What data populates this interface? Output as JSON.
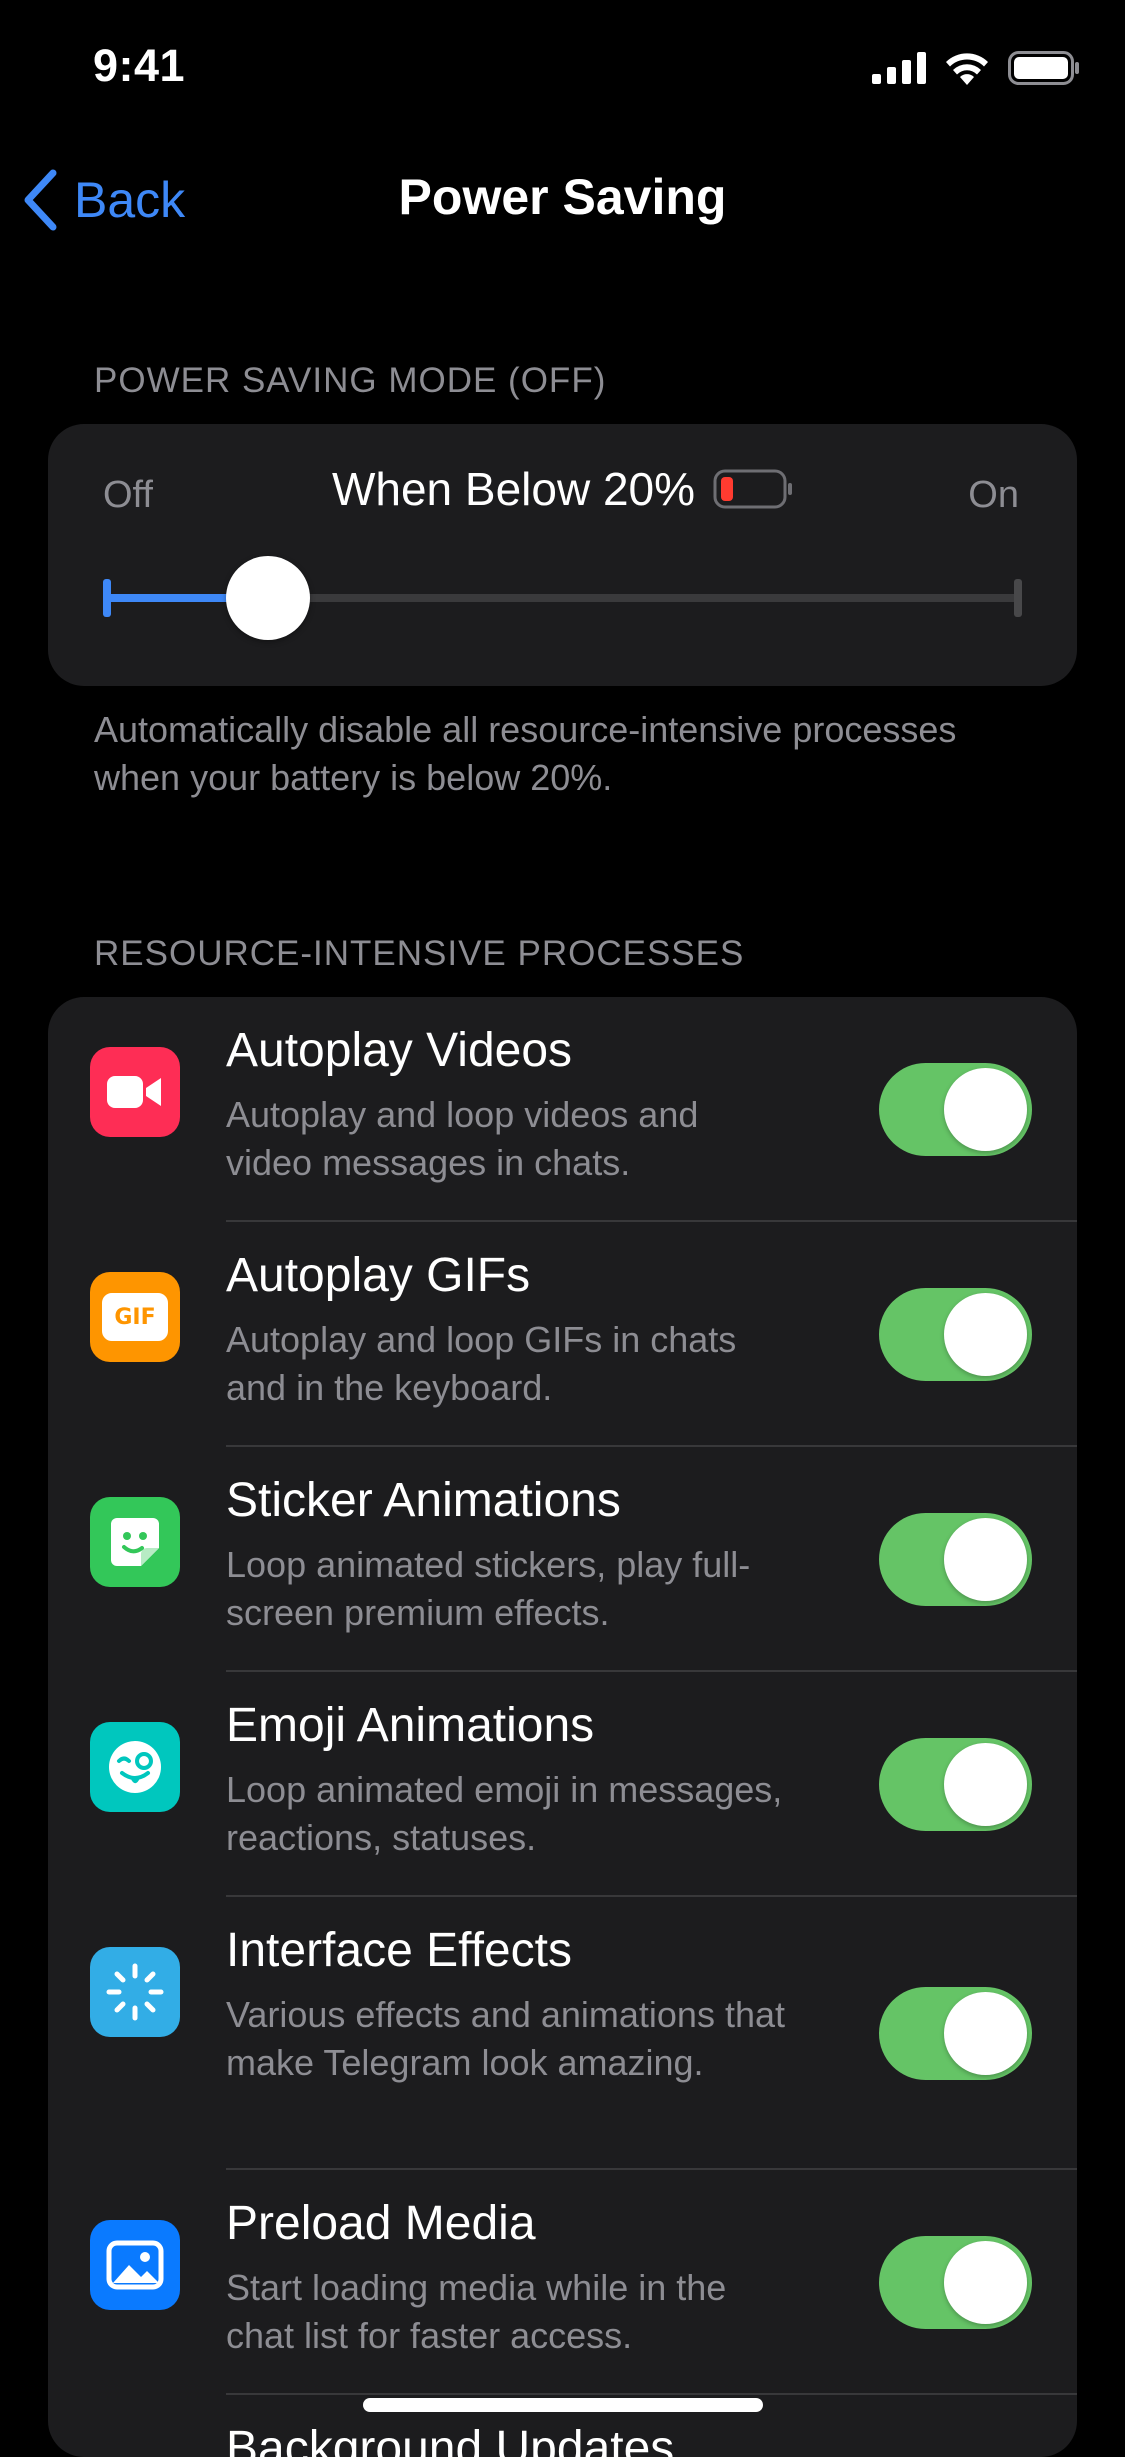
{
  "status_bar": {
    "time": "9:41",
    "icons": [
      "signal-icon",
      "wifi-icon",
      "battery-icon"
    ]
  },
  "nav": {
    "back_label": "Back",
    "title": "Power Saving"
  },
  "power_saving": {
    "section_header": "POWER SAVING MODE (OFF)",
    "off_label": "Off",
    "on_label": "On",
    "threshold_label": "When Below 20%",
    "slider_value_fraction": 0.18,
    "footer": "Automatically disable all resource-intensive processes when your battery is below 20%."
  },
  "processes": {
    "section_header": "RESOURCE-INTENSIVE PROCESSES",
    "items": [
      {
        "title": "Autoplay Videos",
        "subtitle": "Autoplay and loop videos and video messages in chats.",
        "icon": "video-camera-icon",
        "color": "#fe2d55",
        "enabled": true
      },
      {
        "title": "Autoplay GIFs",
        "subtitle": "Autoplay and loop GIFs in chats and in the keyboard.",
        "icon": "gif-icon",
        "icon_text": "GIF",
        "color": "#fe9500",
        "enabled": true
      },
      {
        "title": "Sticker Animations",
        "subtitle": "Loop animated stickers, play full-screen premium effects.",
        "icon": "sticker-icon",
        "color": "#33c759",
        "enabled": true
      },
      {
        "title": "Emoji Animations",
        "subtitle": "Loop animated emoji in messages, reactions, statuses.",
        "icon": "emoji-icon",
        "color": "#00c7be",
        "enabled": true
      },
      {
        "title": "Interface Effects",
        "subtitle": "Various effects and animations that make Telegram look amazing.",
        "icon": "sparkle-icon",
        "color": "#32ade6",
        "enabled": true
      },
      {
        "title": "Preload Media",
        "subtitle": "Start loading media while in the chat list for faster access.",
        "icon": "image-icon",
        "color": "#0a7aff",
        "enabled": true
      },
      {
        "title": "Background Updates",
        "subtitle": "",
        "icon": "refresh-icon",
        "color": "#5856d6",
        "enabled": true
      }
    ]
  },
  "colors": {
    "accent": "#3e88f7",
    "toggle_on": "#65c466",
    "card": "#1c1c1e",
    "secondary_text": "#8d8d93"
  }
}
